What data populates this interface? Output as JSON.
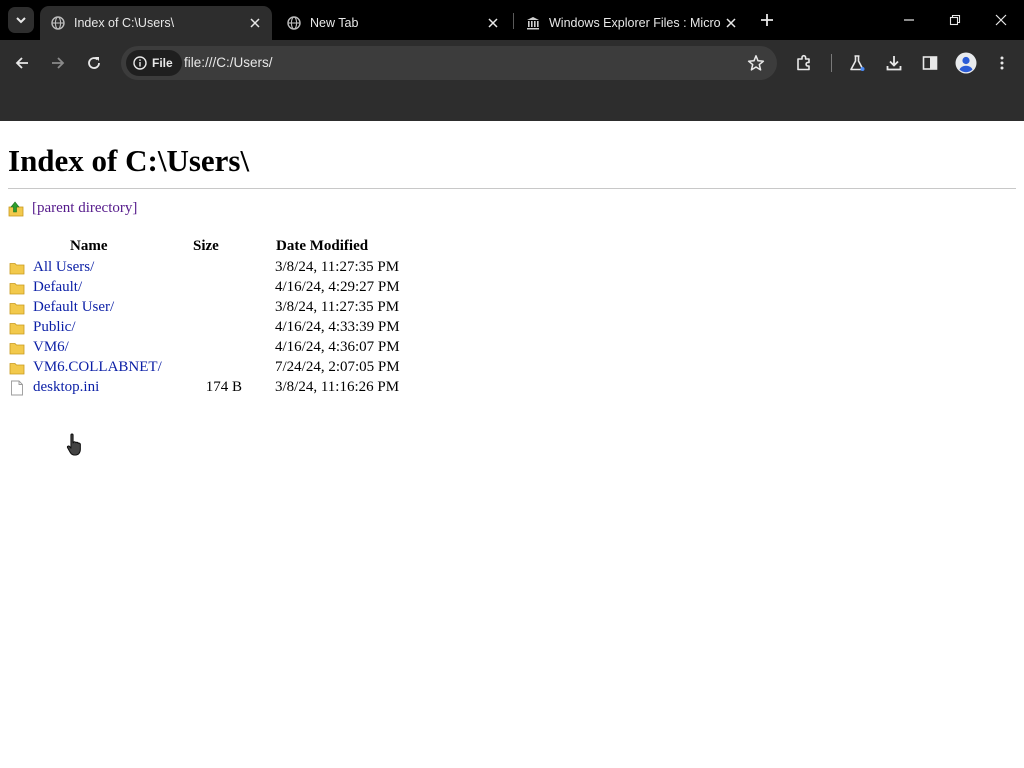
{
  "browser": {
    "tabs": [
      {
        "title": "Index of C:\\Users\\",
        "active": true,
        "icon": "globe-icon"
      },
      {
        "title": "New Tab",
        "active": false,
        "icon": "globe-icon"
      },
      {
        "title": "Windows Explorer Files : Micro",
        "active": false,
        "icon": "bank-icon"
      }
    ],
    "chip_label": "File",
    "url": "file:///C:/Users/"
  },
  "page": {
    "heading": "Index of C:\\Users\\",
    "parent_link": "[parent directory]",
    "columns": {
      "name": "Name",
      "size": "Size",
      "date": "Date Modified"
    },
    "entries": [
      {
        "name": "All Users/",
        "size": "",
        "date": "3/8/24, 11:27:35 PM",
        "type": "folder"
      },
      {
        "name": "Default/",
        "size": "",
        "date": "4/16/24, 4:29:27 PM",
        "type": "folder"
      },
      {
        "name": "Default User/",
        "size": "",
        "date": "3/8/24, 11:27:35 PM",
        "type": "folder"
      },
      {
        "name": "Public/",
        "size": "",
        "date": "4/16/24, 4:33:39 PM",
        "type": "folder"
      },
      {
        "name": "VM6/",
        "size": "",
        "date": "4/16/24, 4:36:07 PM",
        "type": "folder"
      },
      {
        "name": "VM6.COLLABNET/",
        "size": "",
        "date": "7/24/24, 2:07:05 PM",
        "type": "folder"
      },
      {
        "name": "desktop.ini",
        "size": "174 B",
        "date": "3/8/24, 11:16:26 PM",
        "type": "file"
      }
    ]
  },
  "colors": {
    "tabstrip_bg": "#000000",
    "toolbar_bg": "#2d2d2d",
    "link": "#0b1fa6",
    "visited_link": "#551a8b",
    "folder": "#f2c94c"
  }
}
